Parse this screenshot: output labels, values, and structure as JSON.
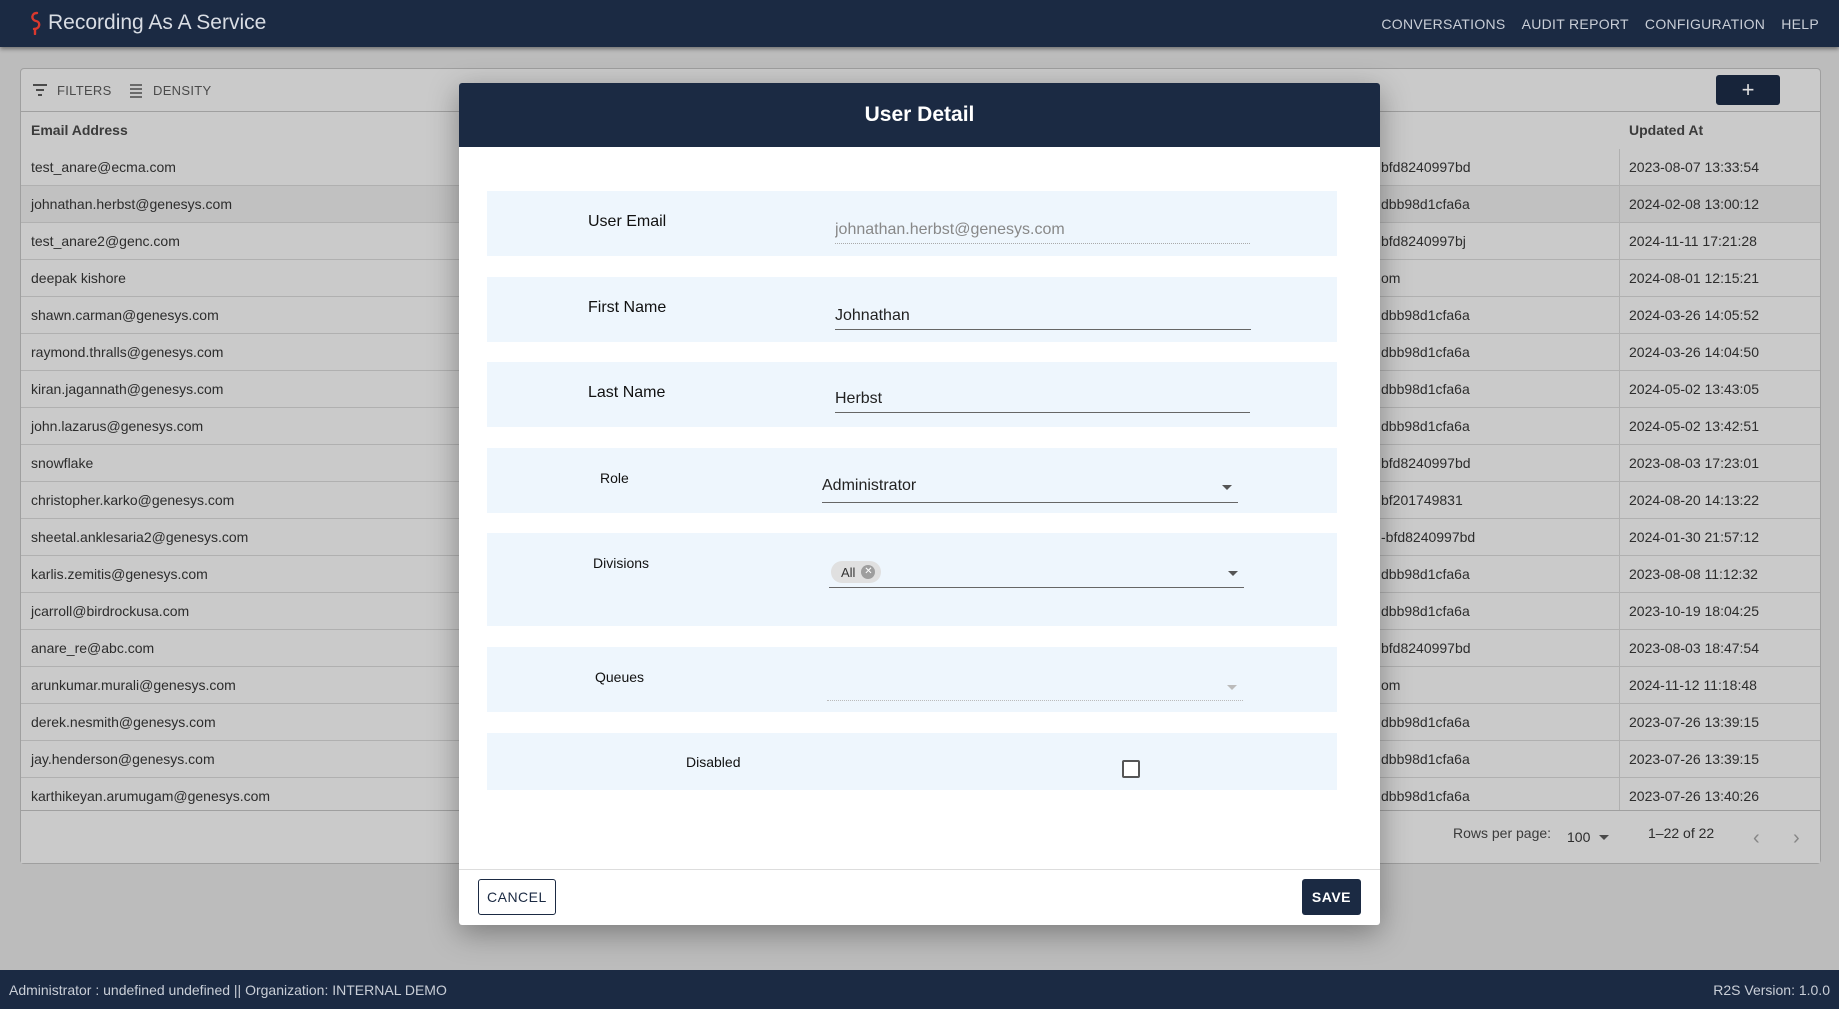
{
  "app": {
    "title": "Recording As A Service"
  },
  "nav": [
    "CONVERSATIONS",
    "AUDIT REPORT",
    "CONFIGURATION",
    "HELP"
  ],
  "toolbar": {
    "filters": "FILTERS",
    "density": "DENSITY",
    "add": "+"
  },
  "table": {
    "columns": [
      "Email Address",
      "Updated At"
    ],
    "rows": [
      [
        "test_anare@ecma.com",
        "bfd8240997bd",
        "2023-08-07 13:33:54"
      ],
      [
        "johnathan.herbst@genesys.com",
        "dbb98d1cfa6a",
        "2024-02-08 13:00:12"
      ],
      [
        "test_anare2@genc.com",
        "bfd8240997bj",
        "2024-11-11 17:21:28"
      ],
      [
        "deepak kishore",
        "om",
        "2024-08-01 12:15:21"
      ],
      [
        "shawn.carman@genesys.com",
        "dbb98d1cfa6a",
        "2024-03-26 14:05:52"
      ],
      [
        "raymond.thralls@genesys.com",
        "dbb98d1cfa6a",
        "2024-03-26 14:04:50"
      ],
      [
        "kiran.jagannath@genesys.com",
        "dbb98d1cfa6a",
        "2024-05-02 13:43:05"
      ],
      [
        "john.lazarus@genesys.com",
        "dbb98d1cfa6a",
        "2024-05-02 13:42:51"
      ],
      [
        "snowflake",
        "bfd8240997bd",
        "2023-08-03 17:23:01"
      ],
      [
        "christopher.karko@genesys.com",
        "bf201749831",
        "2024-08-20 14:13:22"
      ],
      [
        "sheetal.anklesaria2@genesys.com",
        "-bfd8240997bd",
        "2024-01-30 21:57:12"
      ],
      [
        "karlis.zemitis@genesys.com",
        "dbb98d1cfa6a",
        "2023-08-08 11:12:32"
      ],
      [
        "jcarroll@birdrockusa.com",
        "dbb98d1cfa6a",
        "2023-10-19 18:04:25"
      ],
      [
        "anare_re@abc.com",
        "bfd8240997bd",
        "2023-08-03 18:47:54"
      ],
      [
        "arunkumar.murali@genesys.com",
        "om",
        "2024-11-12 11:18:48"
      ],
      [
        "derek.nesmith@genesys.com",
        "dbb98d1cfa6a",
        "2023-07-26 13:39:15"
      ],
      [
        "jay.henderson@genesys.com",
        "dbb98d1cfa6a",
        "2023-07-26 13:39:15"
      ],
      [
        "karthikeyan.arumugam@genesys.com",
        "dbb98d1cfa6a",
        "2023-07-26 13:40:26"
      ]
    ],
    "selected_row": 1
  },
  "pagination": {
    "rows_per_page_label": "Rows per page:",
    "rows_per_page": "100",
    "range": "1–22 of 22",
    "prev": "‹",
    "next": "›"
  },
  "modal": {
    "title": "User Detail",
    "user_email_label": "User Email",
    "user_email_value": "johnathan.herbst@genesys.com",
    "first_name_label": "First Name",
    "first_name_value": "Johnathan",
    "last_name_label": "Last Name",
    "last_name_value": "Herbst",
    "role_label": "Role",
    "role_value": "Administrator",
    "divisions_label": "Divisions",
    "divisions_chip": "All",
    "queues_label": "Queues",
    "disabled_label": "Disabled",
    "disabled_checked": false,
    "cancel": "CANCEL",
    "save": "SAVE"
  },
  "status": {
    "left": "Administrator : undefined undefined || Organization: INTERNAL DEMO",
    "right": "R2S Version: 1.0.0"
  },
  "colors": {
    "primary": "#1b2a43",
    "field_bg": "#eef6fd"
  }
}
